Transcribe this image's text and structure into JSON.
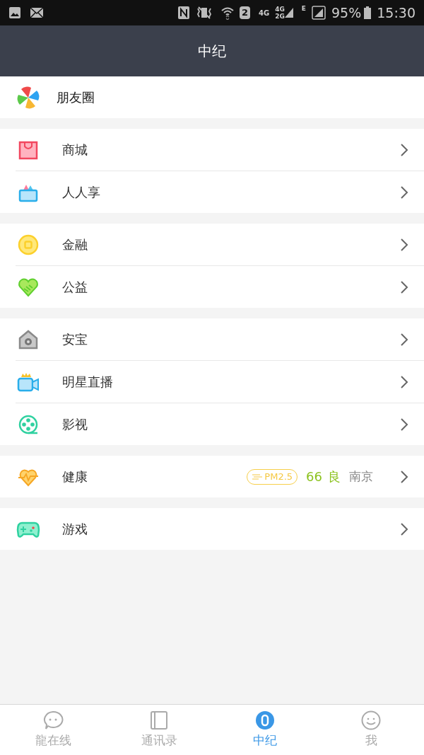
{
  "status_bar": {
    "sim": "2",
    "net1": "4G",
    "net2_top": "4G",
    "net2_bottom": "2G",
    "net3": "E",
    "battery": "95%",
    "time": "15:30"
  },
  "header": {
    "title": "中纪"
  },
  "groups": [
    {
      "items": [
        {
          "label": "朋友圈",
          "chevron": false
        }
      ]
    },
    {
      "items": [
        {
          "label": "商城",
          "chevron": true
        },
        {
          "label": "人人享",
          "chevron": true
        }
      ]
    },
    {
      "items": [
        {
          "label": "金融",
          "chevron": true
        },
        {
          "label": "公益",
          "chevron": true
        }
      ]
    },
    {
      "items": [
        {
          "label": "安宝",
          "chevron": true
        },
        {
          "label": "明星直播",
          "chevron": true
        },
        {
          "label": "影视",
          "chevron": true
        }
      ]
    },
    {
      "items": [
        {
          "label": "健康",
          "chevron": true,
          "air": {
            "badge": "PM2.5",
            "value": "66",
            "grade": "良",
            "city": "南京"
          }
        }
      ]
    },
    {
      "items": [
        {
          "label": "游戏",
          "chevron": true
        }
      ]
    }
  ],
  "tabs": [
    {
      "label": "龍在线",
      "selected": false
    },
    {
      "label": "通讯录",
      "selected": false
    },
    {
      "label": "中纪",
      "selected": true
    },
    {
      "label": "我",
      "selected": false
    }
  ]
}
